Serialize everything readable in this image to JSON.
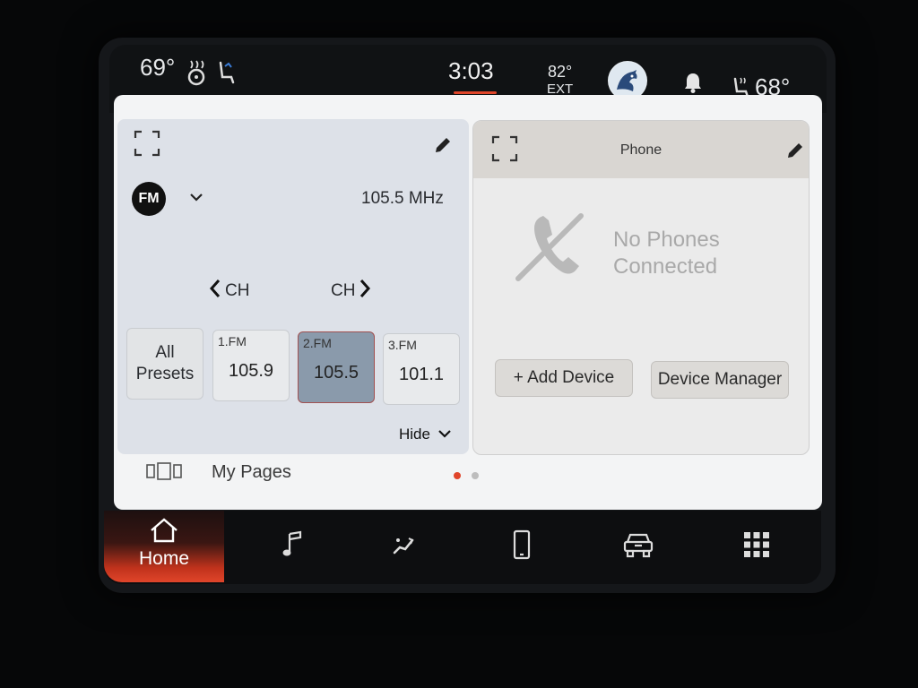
{
  "status_bar": {
    "left_temp": "69°",
    "clock": "3:03",
    "ext_temp": "82°",
    "ext_label": "EXT",
    "right_temp": "68°"
  },
  "radio": {
    "band": "FM",
    "frequency": "105.5 MHz",
    "ch_prev": "CH",
    "ch_next": "CH",
    "all_presets_line1": "All",
    "all_presets_line2": "Presets",
    "presets": [
      {
        "label": "1.FM",
        "value": "105.9"
      },
      {
        "label": "2.FM",
        "value": "105.5"
      },
      {
        "label": "3.FM",
        "value": "101.1"
      }
    ],
    "hide_label": "Hide"
  },
  "phone": {
    "title": "Phone",
    "status_line1": "No Phones",
    "status_line2": "Connected",
    "add_device": "+ Add Device",
    "device_manager": "Device Manager"
  },
  "footer": {
    "my_pages": "My Pages"
  },
  "nav": {
    "home": "Home"
  },
  "colors": {
    "accent": "#e0452a",
    "selected_preset": "#8a9aab"
  }
}
